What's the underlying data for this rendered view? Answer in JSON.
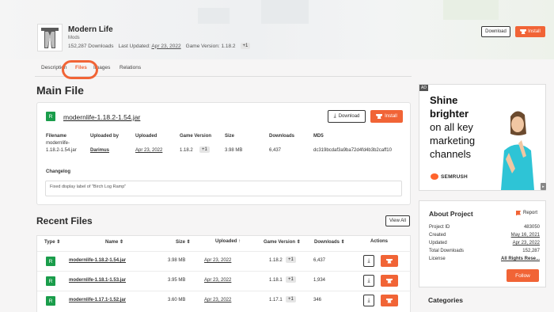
{
  "header": {
    "title": "Modern Life",
    "category": "Mods",
    "downloads": "152,287 Downloads",
    "last_updated_label": "Last Updated:",
    "last_updated": "Apr 23, 2022",
    "game_version_label": "Game Version: 1.18.2",
    "extra_versions": "+1",
    "download_label": "Download",
    "install_label": "Install"
  },
  "tabs": [
    {
      "label": "Description"
    },
    {
      "label": "Files"
    },
    {
      "label": "Images"
    },
    {
      "label": "Relations"
    }
  ],
  "main_file": {
    "heading": "Main File",
    "badge": "R",
    "filename_link": "modernlife-1.18.2-1.54.jar",
    "download_label": "Download",
    "install_label": "Install",
    "headers": {
      "filename": "Filename",
      "uploaded_by": "Uploaded by",
      "uploaded": "Uploaded",
      "game_version": "Game Version",
      "size": "Size",
      "downloads": "Downloads",
      "md5": "MD5"
    },
    "values": {
      "filename_line1": "modernlife-",
      "filename_line2": "1.18.2-1.54.jar",
      "uploaded_by": "Darimus",
      "uploaded": "Apr 23, 2022",
      "game_version": "1.18.2",
      "game_version_extra": "+1",
      "size": "3.98 MB",
      "downloads": "6,437",
      "md5": "dc319bcdaf3a9ba72d4fd4b3b2caff10"
    },
    "changelog_label": "Changelog",
    "changelog_text": "Fixed display label of \"Birch Log Ramp\""
  },
  "recent_files": {
    "heading": "Recent Files",
    "view_all_label": "View All",
    "columns": [
      "Type",
      "Name",
      "Size",
      "Uploaded",
      "Game Version",
      "Downloads",
      "Actions"
    ],
    "rows": [
      {
        "type": "R",
        "name": "modernlife-1.18.2-1.54.jar",
        "size": "3.98 MB",
        "uploaded": "Apr 23, 2022",
        "version": "1.18.2",
        "extra": "+1",
        "downloads": "6,437"
      },
      {
        "type": "R",
        "name": "modernlife-1.18.1-1.53.jar",
        "size": "3.95 MB",
        "uploaded": "Apr 23, 2022",
        "version": "1.18.1",
        "extra": "+1",
        "downloads": "1,934"
      },
      {
        "type": "R",
        "name": "modernlife-1.17.1-1.52.jar",
        "size": "3.60 MB",
        "uploaded": "Apr 23, 2022",
        "version": "1.17.1",
        "extra": "+1",
        "downloads": "346"
      }
    ]
  },
  "ad": {
    "tag": "AD",
    "line1": "Shine brighter",
    "line2": "on all key marketing channels",
    "brand": "SEMRUSH"
  },
  "about": {
    "title": "About Project",
    "report_label": "Report",
    "fields": [
      {
        "key": "Project ID",
        "value": "483050"
      },
      {
        "key": "Created",
        "value": "May 16, 2021"
      },
      {
        "key": "Updated",
        "value": "Apr 23, 2022"
      },
      {
        "key": "Total Downloads",
        "value": "152,287"
      },
      {
        "key": "License",
        "value": "All Rights Rese..."
      }
    ],
    "follow_label": "Follow"
  },
  "categories_heading": "Categories",
  "colors": {
    "accent": "#f16436",
    "release_badge": "#1a9d4b"
  }
}
